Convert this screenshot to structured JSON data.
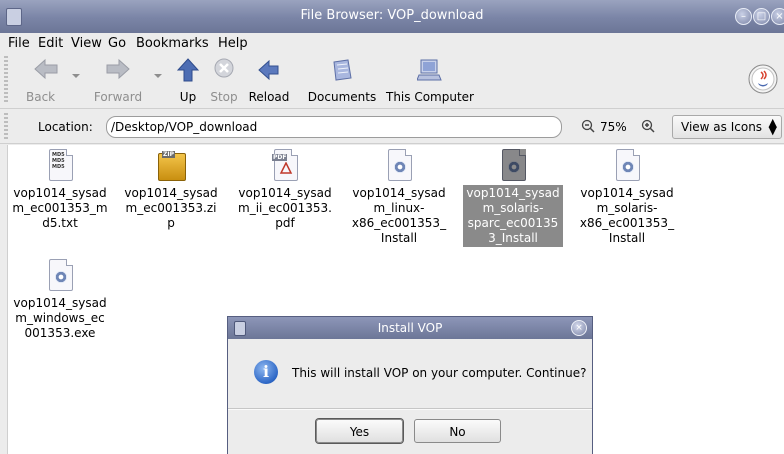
{
  "window": {
    "title": "File Browser: VOP_download"
  },
  "menubar": {
    "items": [
      "File",
      "Edit",
      "View",
      "Go",
      "Bookmarks",
      "Help"
    ]
  },
  "toolbar": {
    "back_label": "Back",
    "forward_label": "Forward",
    "up_label": "Up",
    "stop_label": "Stop",
    "reload_label": "Reload",
    "documents_label": "Documents",
    "computer_label": "This Computer"
  },
  "location": {
    "label": "Location:",
    "value": "/Desktop/VOP_download",
    "zoom": "75%",
    "view_mode": "View as Icons"
  },
  "files": [
    {
      "name": "vop1014_sysad\nm_ec001353_m\nd5.txt",
      "type": "md5-text"
    },
    {
      "name": "vop1014_sysad\nm_ec001353.zi\np",
      "type": "zip"
    },
    {
      "name": "vop1014_sysad\nm_ii_ec001353.\npdf",
      "type": "pdf"
    },
    {
      "name": "vop1014_sysad\nm_linux-\nx86_ec001353_\nInstall",
      "type": "installer"
    },
    {
      "name": "vop1014_sysad\nm_solaris-\nsparc_ec00135\n3_Install",
      "type": "installer",
      "selected": true
    },
    {
      "name": "vop1014_sysad\nm_solaris-\nx86_ec001353_\nInstall",
      "type": "installer"
    },
    {
      "name": "vop1014_sysad\nm_windows_ec\n001353.exe",
      "type": "installer"
    }
  ],
  "dialog": {
    "title": "Install VOP",
    "message": "This will install VOP on your computer.  Continue?",
    "yes_label": "Yes",
    "no_label": "No"
  },
  "colors": {
    "titlebar": "#7a84a6",
    "selection": "#8a8a8a",
    "info_icon": "#2d67c6"
  }
}
